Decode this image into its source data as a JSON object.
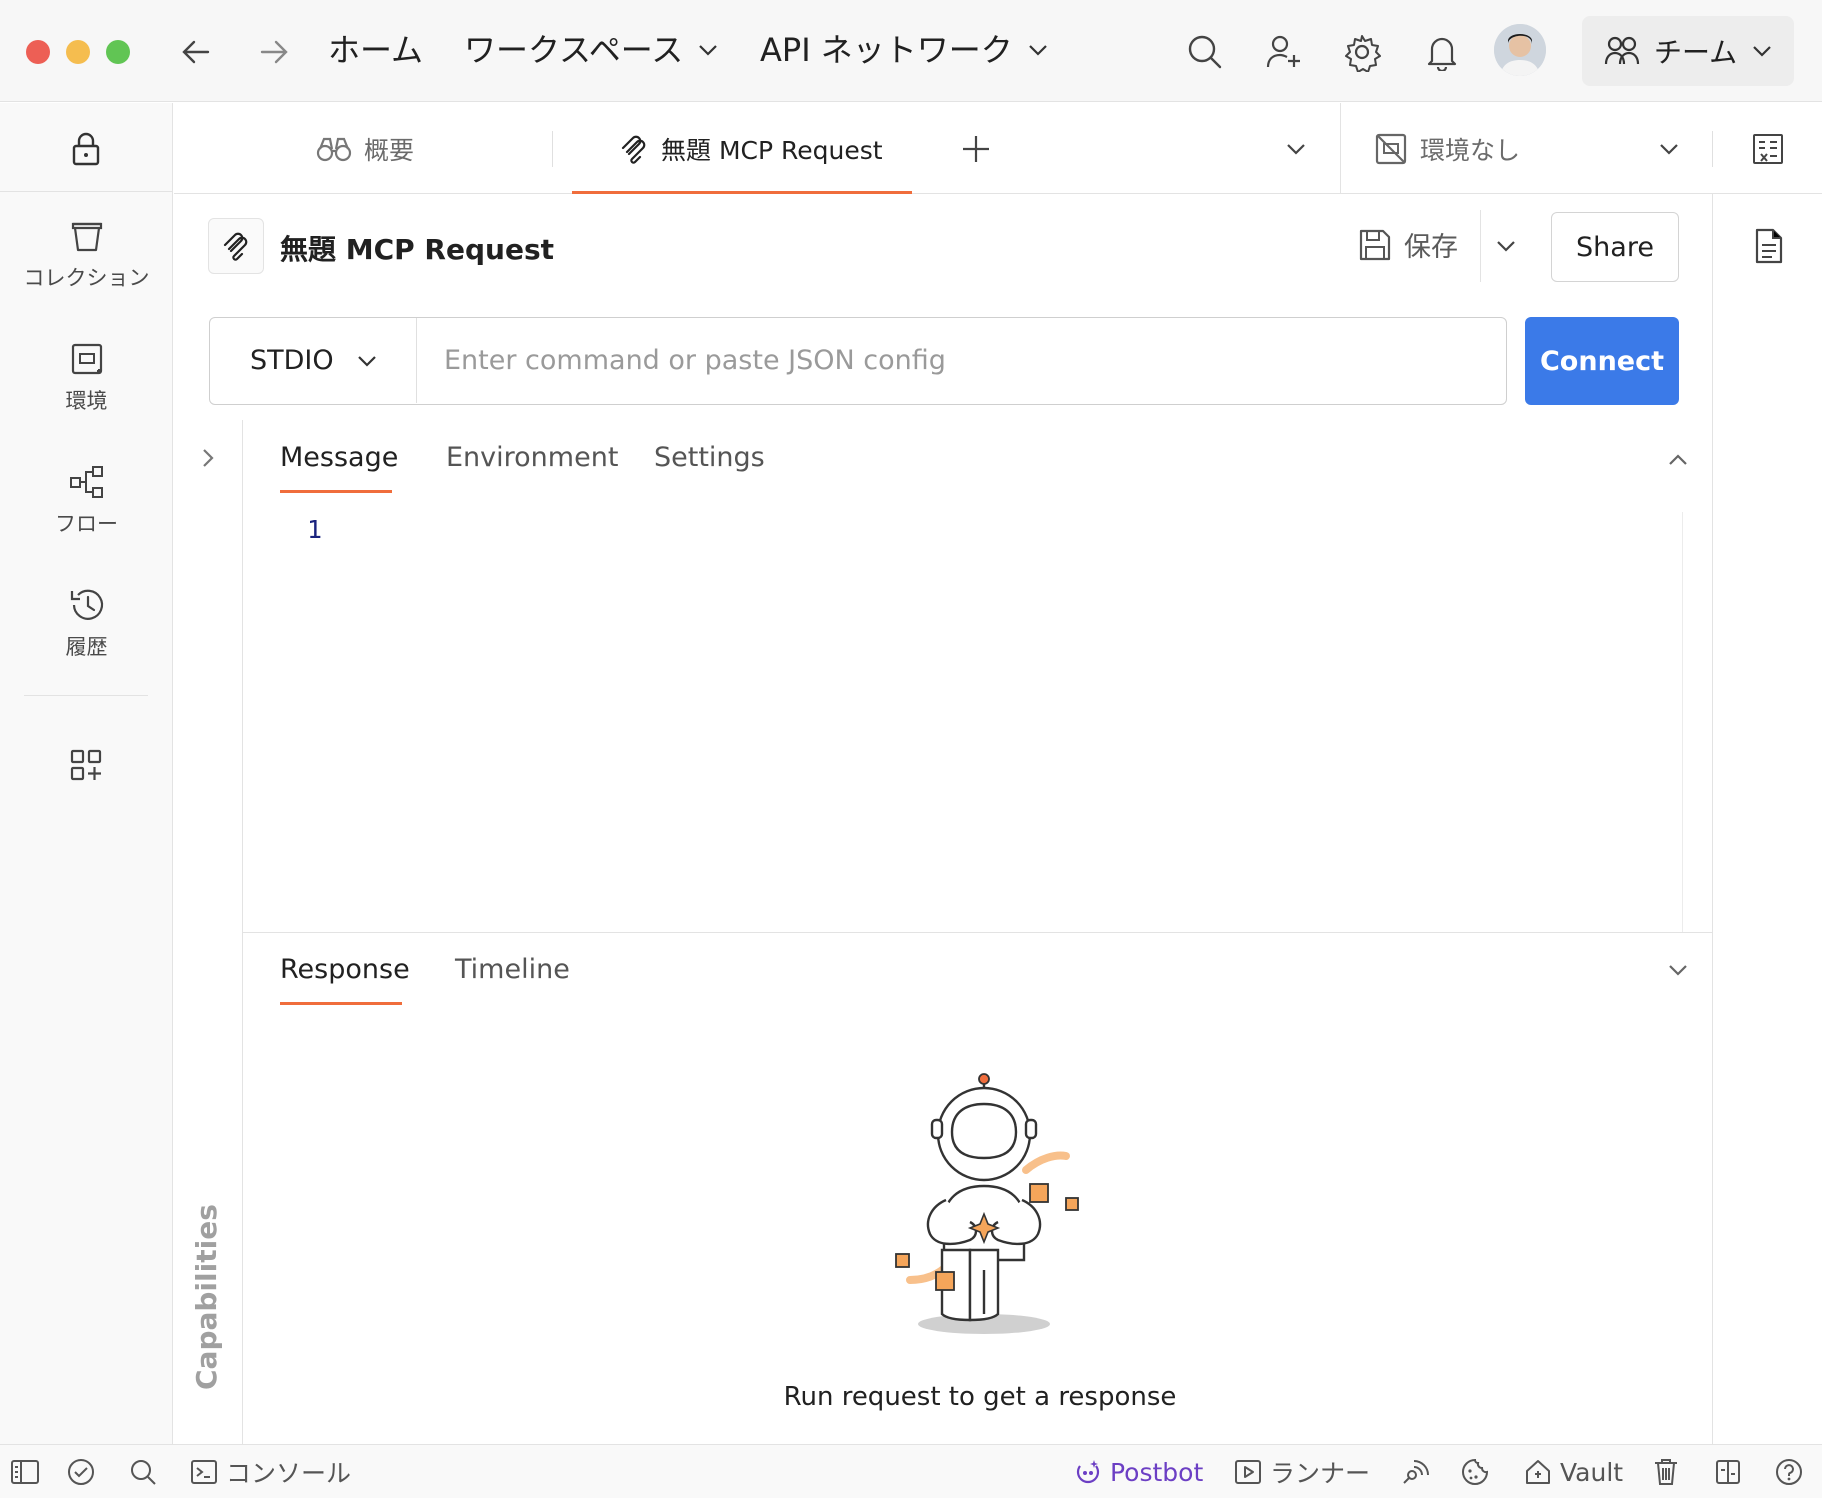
{
  "titlebar": {
    "nav": {
      "home": "ホーム",
      "workspace": "ワークスペース",
      "network": "API ネットワーク"
    },
    "team": "チーム"
  },
  "sidebar": {
    "items": [
      {
        "label": "コレクション",
        "icon": "collection-icon"
      },
      {
        "label": "環境",
        "icon": "environment-icon"
      },
      {
        "label": "フロー",
        "icon": "flows-icon"
      },
      {
        "label": "履歴",
        "icon": "history-icon"
      }
    ]
  },
  "tabs": {
    "overview": "概要",
    "active": "無題 MCP Request",
    "environment": "環境なし"
  },
  "request": {
    "title": "無題 MCP Request",
    "save": "保存",
    "share": "Share",
    "transport": "STDIO",
    "placeholder": "Enter command or paste JSON config",
    "connect": "Connect"
  },
  "message_tabs": [
    "Message",
    "Environment",
    "Settings"
  ],
  "editor": {
    "line_number": "1"
  },
  "response_tabs": [
    "Response",
    "Timeline"
  ],
  "capabilities": "Capabilities",
  "empty_state": "Run request to get a response",
  "statusbar": {
    "console": "コンソール",
    "postbot": "Postbot",
    "runner": "ランナー",
    "vault": "Vault"
  },
  "colors": {
    "accent": "#f06d3c",
    "connect": "#3b7ae8",
    "postbot": "#6c3fc4"
  }
}
